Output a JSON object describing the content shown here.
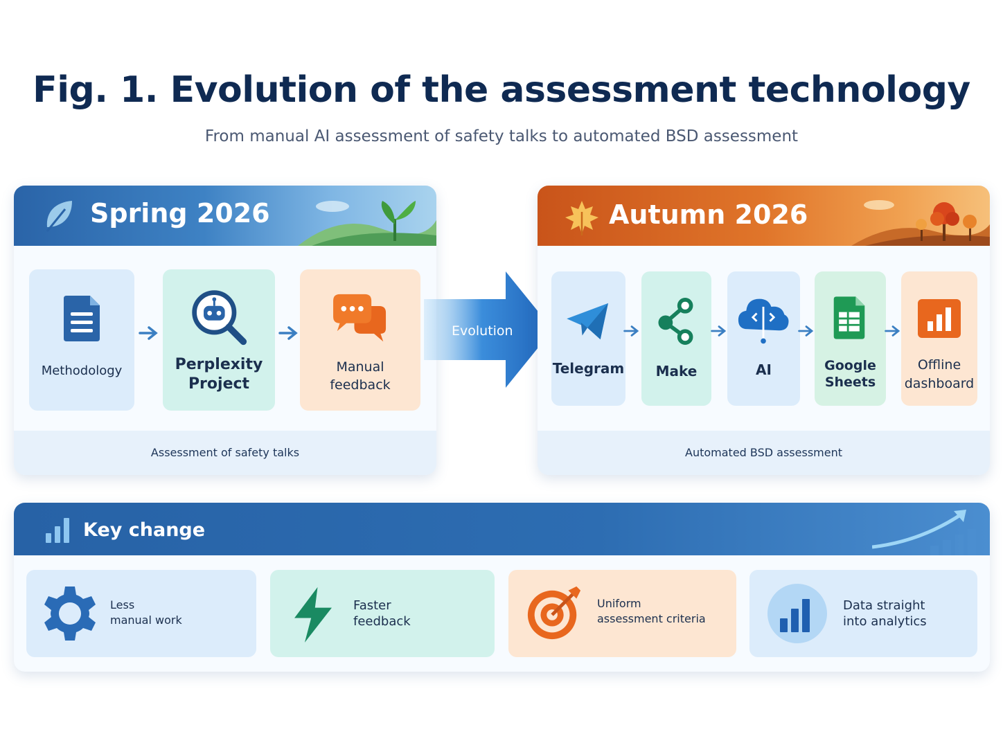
{
  "header": {
    "title": "Fig. 1. Evolution of the assessment technology",
    "subtitle": "From manual AI assessment of safety talks to automated BSD assessment"
  },
  "spring": {
    "title": "Spring 2026",
    "footer": "Assessment of safety talks",
    "steps": [
      {
        "label": "Methodology",
        "icon": "document-icon"
      },
      {
        "label": "Perplexity\nProject",
        "icon": "ai-search-icon"
      },
      {
        "label": "Manual\nfeedback",
        "icon": "chat-bubbles-icon"
      }
    ]
  },
  "evolution": {
    "label": "Evolution"
  },
  "autumn": {
    "title": "Autumn 2026",
    "footer": "Automated BSD assessment",
    "steps": [
      {
        "label": "Telegram",
        "icon": "paper-plane-icon"
      },
      {
        "label": "Make",
        "icon": "share-nodes-icon"
      },
      {
        "label": "AI",
        "icon": "brain-cloud-icon"
      },
      {
        "label": "Google\nSheets",
        "icon": "spreadsheet-icon"
      },
      {
        "label": "Offline\ndashboard",
        "icon": "bar-chart-icon"
      }
    ]
  },
  "key_change": {
    "title": "Key change",
    "items": [
      {
        "label": "Less\nmanual work",
        "icon": "gear-icon"
      },
      {
        "label": "Faster\nfeedback",
        "icon": "lightning-icon"
      },
      {
        "label": "Uniform\nassessment criteria",
        "icon": "target-icon"
      },
      {
        "label": "Data straight\ninto analytics",
        "icon": "bar-chart-icon"
      }
    ]
  },
  "colors": {
    "spring": "#2a64a8",
    "autumn": "#d9621f",
    "key": "#2762a6",
    "title": "#0f2a52"
  }
}
